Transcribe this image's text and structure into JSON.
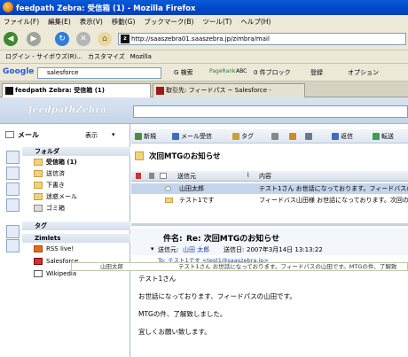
{
  "window": {
    "title": "feedpath Zebra: 受信箱 (1) - Mozilla Firefox"
  },
  "menu": [
    "ファイル(F)",
    "編集(E)",
    "表示(V)",
    "移動(G)",
    "ブックマーク(B)",
    "ツール(T)",
    "ヘルプ(H)"
  ],
  "nav": {
    "url": "http://saaszebra01.saaszebra.jp/zimbra/mail"
  },
  "bookmarks": [
    "ログイン - サイボウズ(R)...",
    "カスタマイズ",
    "Mozilla"
  ],
  "google_bar": {
    "brand": "Google",
    "search_value": "salesforce",
    "buttons": [
      "G 検索",
      "PageRank",
      "ABC",
      "0 件ブロック",
      "登録",
      "オプション"
    ]
  },
  "tabs": [
    {
      "label": "feedpath Zebra: 受信箱 (1)",
      "active": true
    },
    {
      "label": "取引先: フィードパス ~ Salesforce - Develop...",
      "active": false
    }
  ],
  "app": {
    "logo": "feedpathZebra",
    "mail_label": "メール",
    "view_label": "表示",
    "sections": {
      "folders": "フォルダ",
      "tags": "タグ",
      "zimlets": "Zimlets"
    },
    "folders": [
      "受信箱 (1)",
      "送信済",
      "下書き",
      "迷惑メール",
      "ゴミ箱"
    ],
    "zimlets": [
      "RSS live!",
      "Salesforce",
      "Wikipedia"
    ],
    "toolbar": [
      "新規",
      "メール受信",
      "タグ",
      "",
      "",
      "返信",
      "転送"
    ],
    "list_title": "次回MTGのお知らせ",
    "columns": {
      "sender": "送信元",
      "content": "内容"
    },
    "rows": [
      {
        "sender": "山田太郎",
        "content": "テスト1さん お世話になっております。フィードバスの",
        "selected": true
      },
      {
        "sender": "テスト1です",
        "content": "フィードバス山田様 お世話になっております。次回の"
      }
    ],
    "message": {
      "subject_prefix": "件名:",
      "subject": "Re: 次回MTGのお知らせ",
      "from_label": "送信元:",
      "from_name": "山田 太郎",
      "date_label": "送信日:",
      "date": "2007年3月14日 13:13:22",
      "to_label": "To:",
      "to": "テスト1です <test1@saaszebra.jp>",
      "body": [
        "テスト1さん",
        "お世話になっております、フィードパスの山田です。",
        "MTGの件、了解致しました。",
        "宜しくお願い致します。"
      ]
    },
    "drag_preview": {
      "sender": "山田太郎",
      "content": "テスト1さん お世話になっております。フィードパスの山田です。MTGの件、了解致"
    }
  }
}
